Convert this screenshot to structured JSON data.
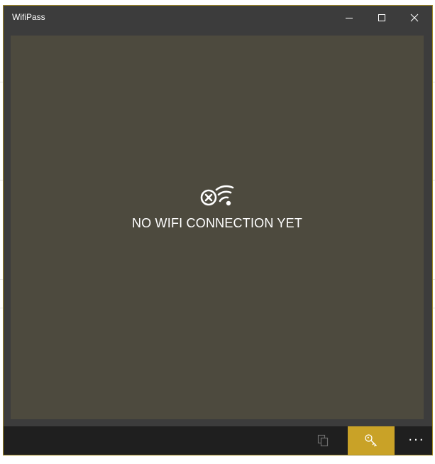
{
  "window": {
    "title": "WifiPass"
  },
  "caption_buttons": {
    "minimize_icon": "minimize-icon",
    "maximize_icon": "maximize-icon",
    "close_icon": "close-icon"
  },
  "empty_state": {
    "icon": "wifi-error-icon",
    "message": "NO WIFI CONNECTION YET"
  },
  "app_bar": {
    "copy_icon": "copy-icon",
    "key_icon": "key-icon",
    "more_label": "···"
  },
  "colors": {
    "content_bg": "#4d4a3e",
    "accent": "#c9a227",
    "titlebar_bg": "#3c3c3c",
    "appbar_bg": "#1f1f1f"
  }
}
